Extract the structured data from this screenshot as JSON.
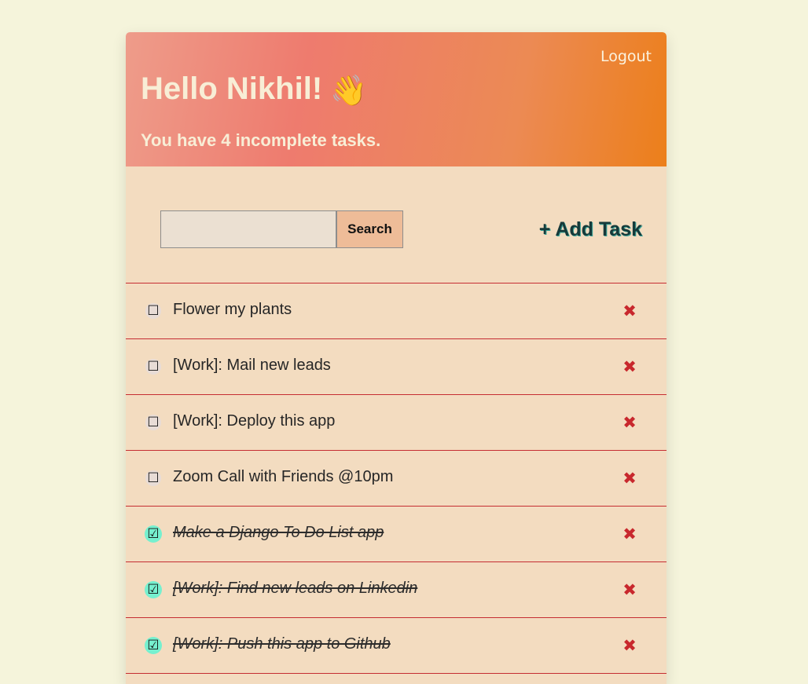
{
  "header": {
    "logout_label": "Logout",
    "greeting": "Hello Nikhil!",
    "greeting_icon": "👋",
    "subtitle": "You have 4 incomplete tasks."
  },
  "toolbar": {
    "search_value": "",
    "search_button_label": "Search",
    "add_task_label": "+ Add Task"
  },
  "tasks": [
    {
      "title": "Flower my plants",
      "complete": false,
      "checkbox_glyph": "☐",
      "delete_icon": "✖"
    },
    {
      "title": "[Work]: Mail new leads",
      "complete": false,
      "checkbox_glyph": "☐",
      "delete_icon": "✖"
    },
    {
      "title": "[Work]: Deploy this app",
      "complete": false,
      "checkbox_glyph": "☐",
      "delete_icon": "✖"
    },
    {
      "title": "Zoom Call with Friends @10pm",
      "complete": false,
      "checkbox_glyph": "☐",
      "delete_icon": "✖"
    },
    {
      "title": "Make a Django To Do List app",
      "complete": true,
      "checkbox_glyph": "☑",
      "delete_icon": "✖"
    },
    {
      "title": "[Work]: Find new leads on Linkedin",
      "complete": true,
      "checkbox_glyph": "☑",
      "delete_icon": "✖"
    },
    {
      "title": "[Work]: Push this app to Github",
      "complete": true,
      "checkbox_glyph": "☑",
      "delete_icon": "✖"
    }
  ],
  "colors": {
    "page_background": "#f5f4db",
    "card_background": "#f3dcc0",
    "divider": "#c52d32",
    "delete": "#c8282d",
    "checked_badge": "#76f0cf",
    "add_task_text": "#163a3a"
  }
}
